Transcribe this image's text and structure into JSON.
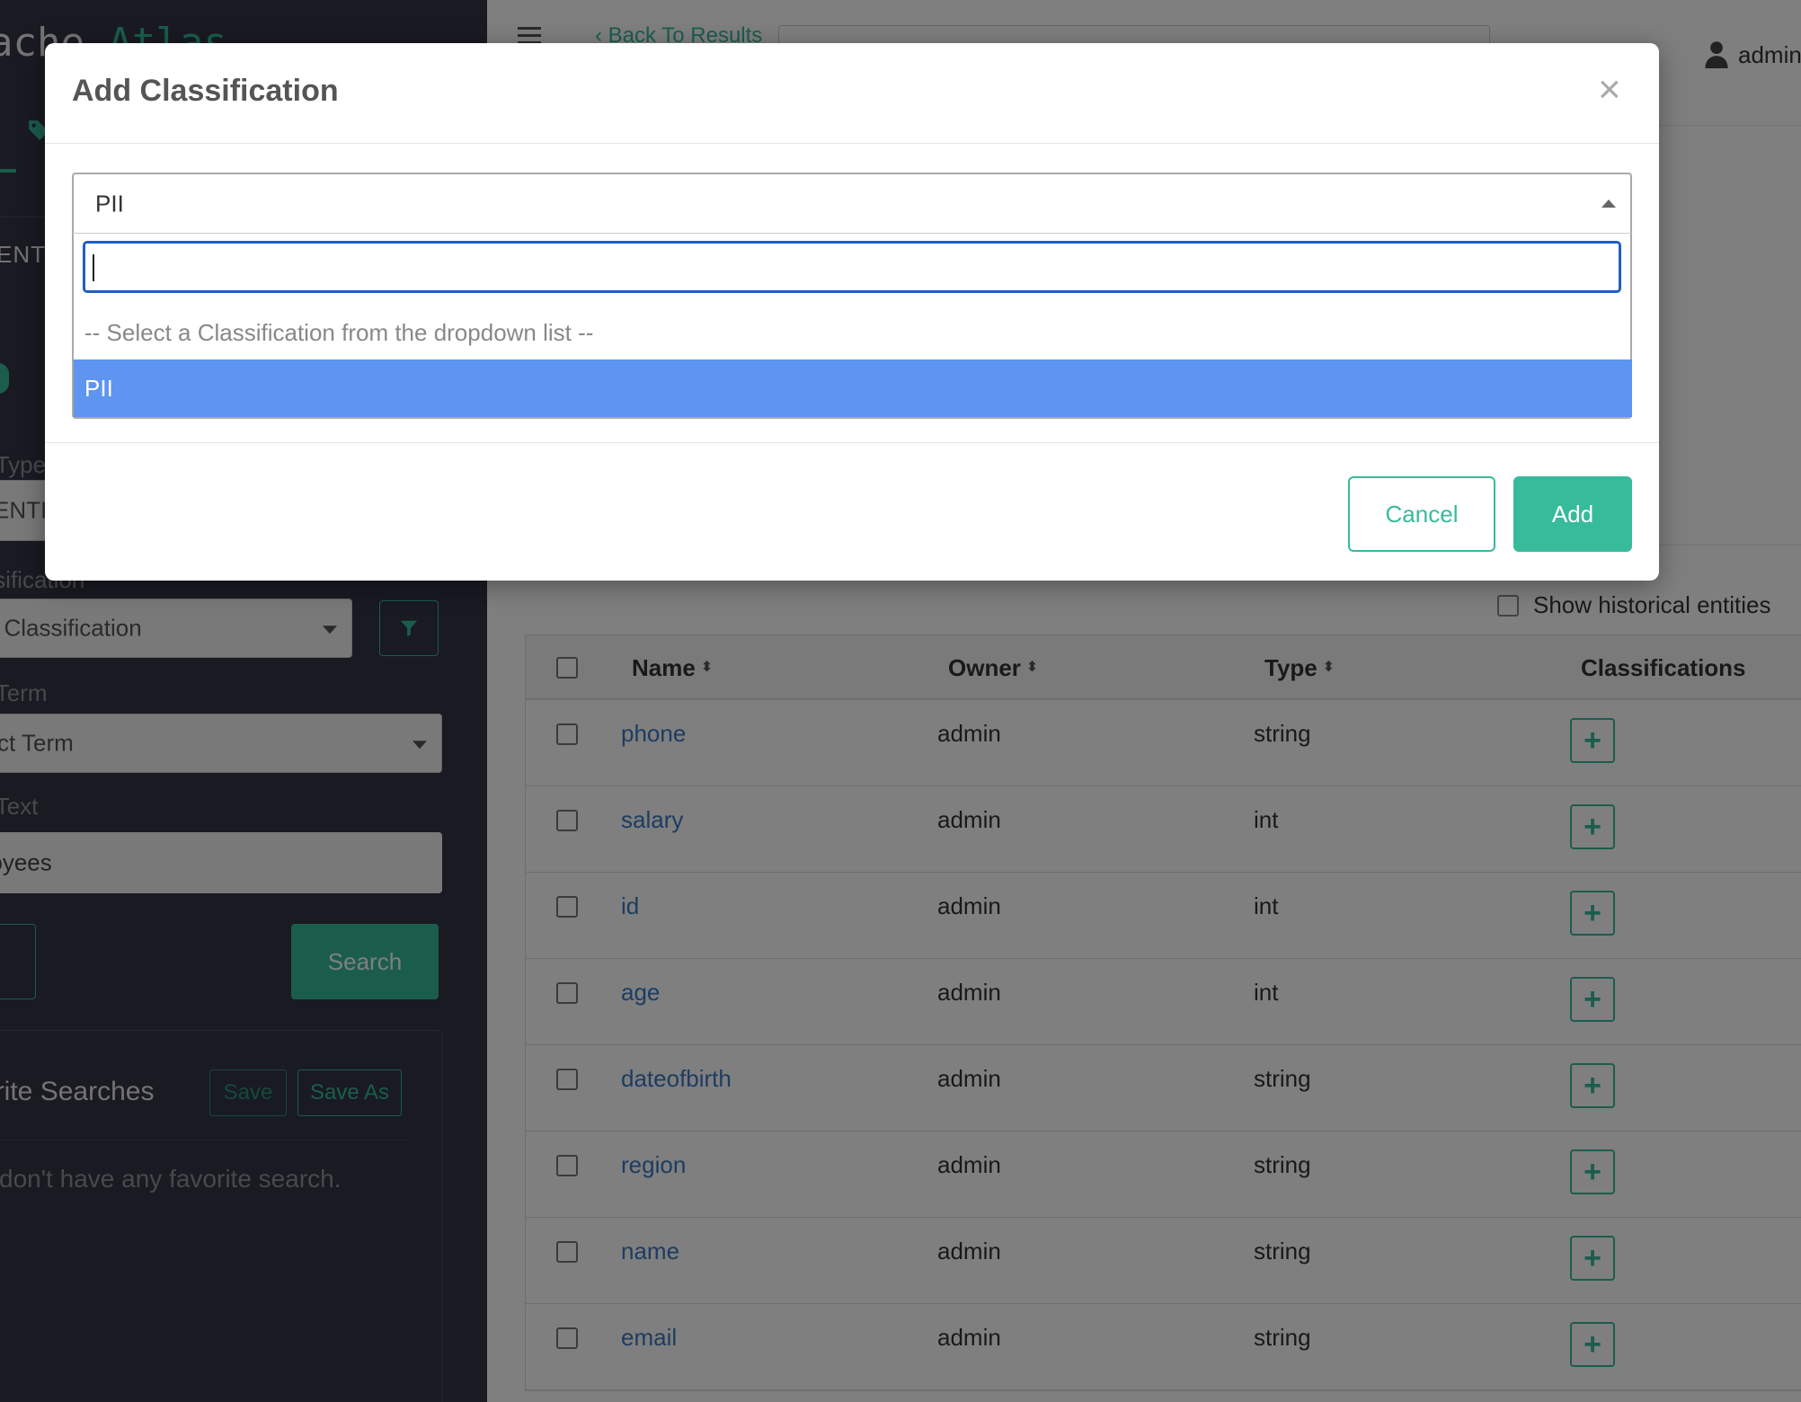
{
  "app": {
    "logo_prefix": "ache ",
    "logo_accent": "Atlas"
  },
  "sidebar": {
    "heading": "ENTITIES",
    "type_label": "Search By Type",
    "type_value": "ENTITY",
    "classification_label": "Search By Classification",
    "classification_value": "Select Classification",
    "term_label": "Search By Term",
    "term_value": "Select Term",
    "text_label": "Search By Text",
    "text_value": "employees",
    "search_button": "Search",
    "favorites_title": "Favorite Searches",
    "save_button": "Save",
    "save_as_button": "Save As",
    "favorites_empty": "You don't have any favorite search."
  },
  "topbar": {
    "back_label": "Back To Results",
    "user_name": "admin"
  },
  "main": {
    "show_historical_label": "Show historical entities",
    "columns": [
      "Name",
      "Owner",
      "Type",
      "Classifications"
    ],
    "rows": [
      {
        "name": "phone",
        "owner": "admin",
        "type": "string"
      },
      {
        "name": "salary",
        "owner": "admin",
        "type": "int"
      },
      {
        "name": "id",
        "owner": "admin",
        "type": "int"
      },
      {
        "name": "age",
        "owner": "admin",
        "type": "int"
      },
      {
        "name": "dateofbirth",
        "owner": "admin",
        "type": "string"
      },
      {
        "name": "region",
        "owner": "admin",
        "type": "string"
      },
      {
        "name": "name",
        "owner": "admin",
        "type": "string"
      },
      {
        "name": "email",
        "owner": "admin",
        "type": "string"
      }
    ],
    "add_classification_glyph": "+"
  },
  "modal": {
    "title": "Add Classification",
    "close_glyph": "×",
    "selected_value": "PII",
    "search_value": "",
    "placeholder_option": "-- Select a Classification from the dropdown list --",
    "options": [
      "PII"
    ],
    "cancel_label": "Cancel",
    "add_label": "Add"
  },
  "colors": {
    "accent": "#37bb9b",
    "sidebar_bg": "#323544",
    "link": "#3a78c2",
    "selected_option": "#5d95f0",
    "focus_border": "#1f5fbf"
  },
  "icons": {
    "menu": "hamburger-icon",
    "back": "chevron-left-icon",
    "user": "user-icon",
    "tag": "tag-icon",
    "filter": "filter-icon",
    "sort": "sort-icon",
    "close": "close-icon",
    "add": "plus-icon"
  }
}
